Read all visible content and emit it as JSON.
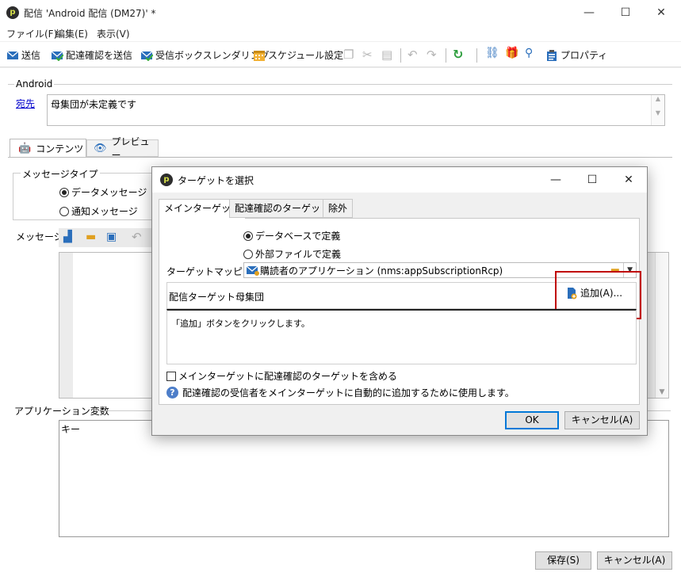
{
  "window": {
    "title": "配信 'Android 配信 (DM27)' *",
    "logo": "p",
    "minimize_glyph": "—",
    "maximize_glyph": "☐",
    "close_glyph": "✕"
  },
  "menu": [
    "ファイル(F)",
    "編集(E)",
    "表示(V)"
  ],
  "toolbar": {
    "send": "送信",
    "send_proof": "配達確認を送信",
    "inbox_rendering": "受信ボックスレンダリング",
    "schedule": "スケジュール設定",
    "properties": "プロパティ"
  },
  "android": {
    "section_label": "Android",
    "recipient_link": "宛先",
    "recipient_value": "母集団が未定義です"
  },
  "tabs": {
    "content": "コンテンツ",
    "preview": "プレビュー"
  },
  "message_type": {
    "label": "メッセージタイプ",
    "options": [
      "データメッセージ",
      "通知メッセージ"
    ],
    "selected": 0
  },
  "message_label": "メッセージ:",
  "app_variables": {
    "label": "アプリケーション変数",
    "key_header": "キー"
  },
  "footer": {
    "save": "保存(S)",
    "cancel": "キャンセル(A)"
  },
  "dialog": {
    "title": "ターゲットを選択",
    "tabs": [
      "メインターゲット",
      "配達確認のターゲット",
      "除外"
    ],
    "active_tab": 0,
    "source_options": [
      "データベースで定義",
      "外部ファイルで定義"
    ],
    "source_selected": 0,
    "mapping_label": "ターゲットマッピング:",
    "mapping_value": "購読者のアプリケーション (nms:appSubscriptionRcp)",
    "population_label": "配信ターゲット母集団",
    "add_button": "追加(A)...",
    "population_hint": "「追加」ボタンをクリックします。",
    "include_proof_label": "メインターゲットに配達確認のターゲットを含める",
    "include_proof_checked": false,
    "info_text": "配達確認の受信者をメインターゲットに自動的に追加するために使用します。",
    "ok": "OK",
    "cancel": "キャンセル(A)"
  },
  "colors": {
    "highlight": "#c00000",
    "link": "#0000cc",
    "default_button_border": "#0078d7"
  }
}
